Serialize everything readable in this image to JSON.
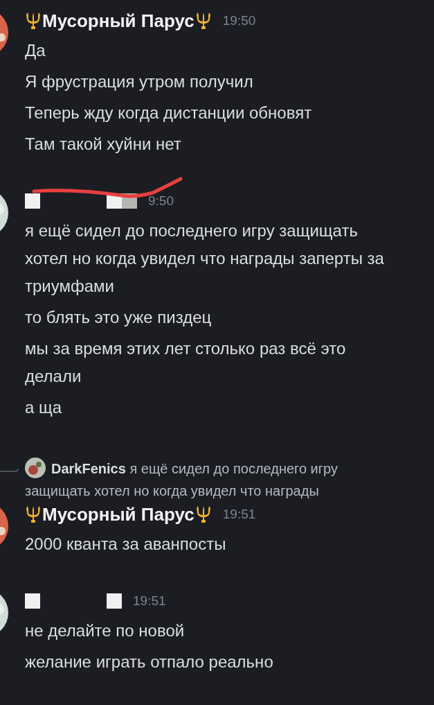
{
  "groups": [
    {
      "kind": "named",
      "author": "Мусорный Парус",
      "time": "19:50",
      "messages": [
        "Да",
        "Я фрустрация утром получил",
        "Теперь жду когда дистанции обновят",
        "Там такой хуйни нет"
      ]
    },
    {
      "kind": "redacted",
      "scribbled": true,
      "time": "9:50",
      "messages": [
        "я ещё сидел до последнего игру защищать хотел но когда увидел что награды заперты за триумфами",
        "то блять это уже пиздец",
        "мы за время этих лет столько раз всё это делали",
        "а ща"
      ]
    },
    {
      "kind": "named",
      "reply": {
        "author": "DarkFenics",
        "text": "я ещё сидел до последнего игру защищать хотел но когда увидел что награды"
      },
      "author": "Мусорный Парус",
      "time": "19:51",
      "messages": [
        "2000 кванта за аванпосты"
      ]
    },
    {
      "kind": "redacted",
      "scribbled": false,
      "time": "19:51",
      "messages": [
        "не делайте по новой",
        "желание играть отпало реально"
      ]
    }
  ]
}
